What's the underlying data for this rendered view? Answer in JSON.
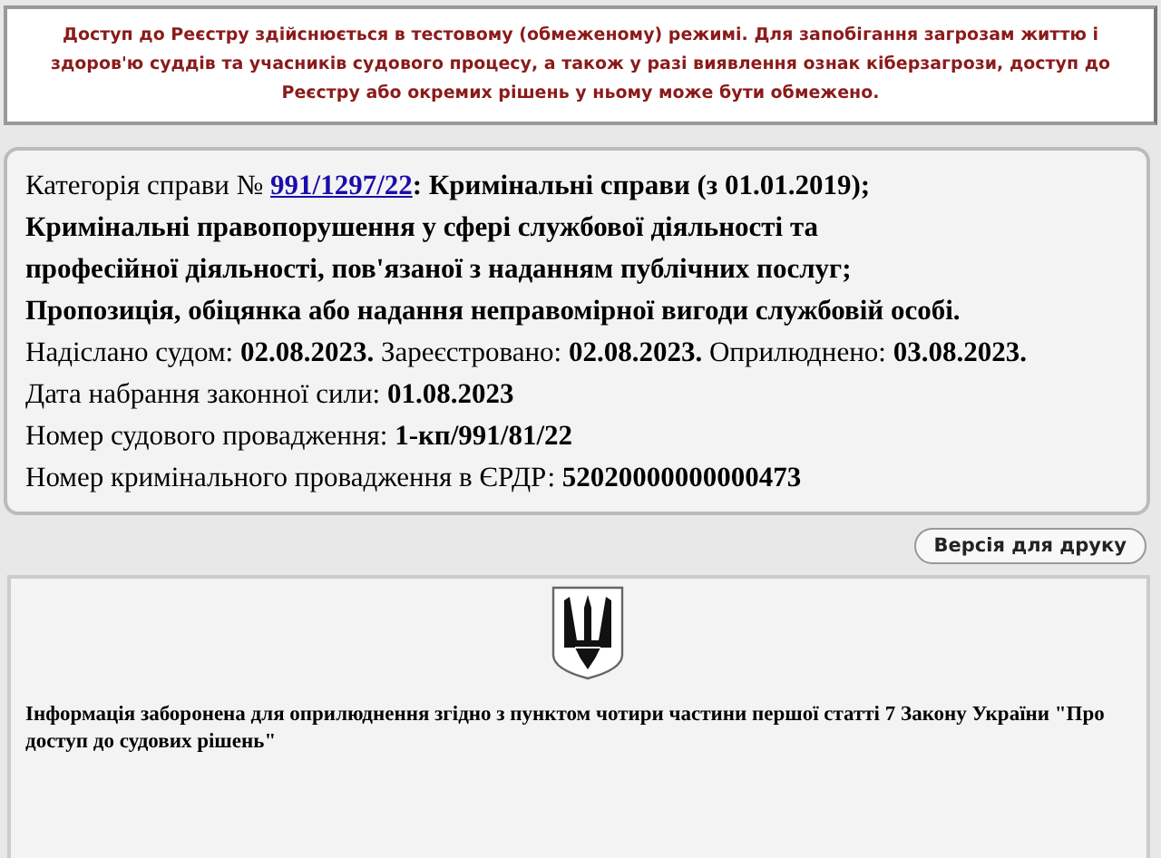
{
  "notice": "Доступ до Реєстру здійснюється в тестовому (обмеженому) режимі. Для запобігання загрозам життю і здоров'ю суддів та учасників судового процесу, а також у разі виявлення ознак кіберзагрози, доступ до Реєстру або окремих рішень у ньому може бути обмежено.",
  "case": {
    "category_label": "Категорія справи №",
    "case_number": "991/1297/22",
    "category": ": Кримінальні справи (з 01.01.2019); Кримінальні правопорушення у сфері службової діяльності та професійної діяльності, пов'язаної з наданням публічних послуг; Пропозиція, обіцянка або надання неправомірної вигоди службовій особі.",
    "details": [
      "Надіслано судом: **02.08.2023.** Зареєстровано: **02.08.2023.** Оприлюднено: **03.08.2023.**",
      "Дата набрання законної сили: **01.08.2023**",
      "Номер судового провадження: **1-кп/991/81/22**",
      "Номер кримінального провадження в ЄРДР: **52020000000000473**"
    ]
  },
  "print_button": "Версія для друку",
  "document": {
    "restriction": "Інформація заборонена для оприлюднення згідно з пунктом чотири частини першої статті 7 Закону України \"Про доступ до судових рішень\""
  }
}
